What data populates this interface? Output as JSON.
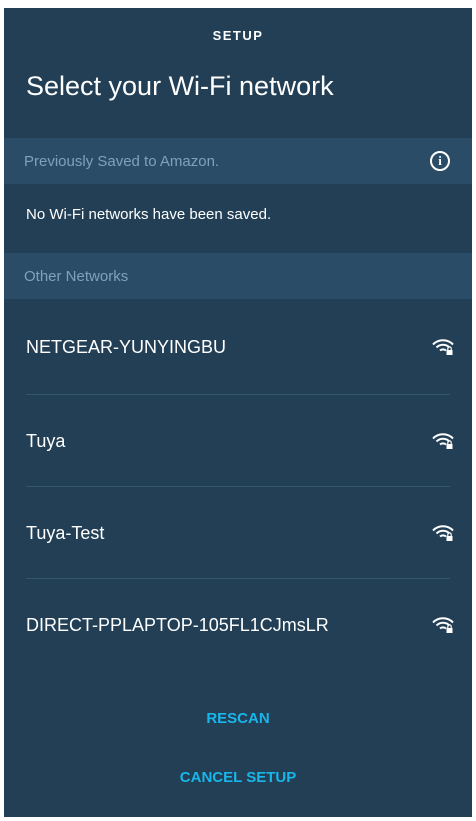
{
  "header": {
    "title": "SETUP"
  },
  "page_title": "Select your Wi-Fi network",
  "saved_section": {
    "label": "Previously Saved to Amazon.",
    "info_icon": "info-circle-icon",
    "empty_message": "No Wi-Fi networks have been saved."
  },
  "other_section": {
    "label": "Other Networks"
  },
  "networks": [
    {
      "ssid": "NETGEAR-YUNYINGBU",
      "icon": "wifi-lock-icon"
    },
    {
      "ssid": "Tuya",
      "icon": "wifi-lock-icon"
    },
    {
      "ssid": "Tuya-Test",
      "icon": "wifi-lock-icon"
    },
    {
      "ssid": "DIRECT-PPLAPTOP-105FL1CJmsLR",
      "icon": "wifi-lock-icon"
    }
  ],
  "actions": {
    "rescan": "RESCAN",
    "cancel": "CANCEL SETUP"
  },
  "colors": {
    "background": "#223f55",
    "section_bg": "#2b4c66",
    "section_text": "#7fa1bb",
    "accent": "#19b6ea",
    "text": "#ffffff"
  }
}
